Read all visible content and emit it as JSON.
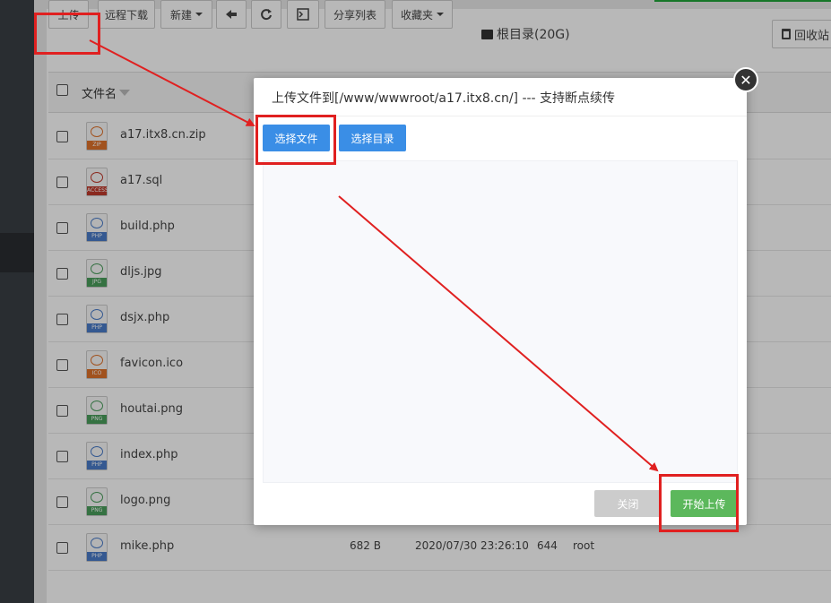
{
  "colors": {
    "accent": "#20a53a",
    "primary_button": "#3a8ee6",
    "success_button": "#5cb85c",
    "disabled_button": "#cccccc",
    "highlight": "#e02020"
  },
  "toolbar": {
    "upload_label": "上传",
    "remote_download_label": "远程下载",
    "new_label": "新建",
    "back_icon": "arrow-left-icon",
    "refresh_icon": "refresh-icon",
    "terminal_icon": "terminal-icon",
    "share_list_label": "分享列表",
    "favorites_label": "收藏夹",
    "root_dir_label": "根目录(20G)",
    "recycle_label": "回收站"
  },
  "table": {
    "header_name": "文件名",
    "rows": [
      {
        "name": "a17.itx8.cn.zip",
        "type": "ZIP",
        "size": "",
        "time": "",
        "perm": "",
        "owner": ""
      },
      {
        "name": "a17.sql",
        "type": "ACCESS",
        "size": "",
        "time": "",
        "perm": "",
        "owner": ""
      },
      {
        "name": "build.php",
        "type": "PHP",
        "size": "",
        "time": "",
        "perm": "",
        "owner": ""
      },
      {
        "name": "dljs.jpg",
        "type": "JPG",
        "size": "",
        "time": "",
        "perm": "",
        "owner": ""
      },
      {
        "name": "dsjx.php",
        "type": "PHP",
        "size": "",
        "time": "",
        "perm": "",
        "owner": ""
      },
      {
        "name": "favicon.ico",
        "type": "ICO",
        "size": "",
        "time": "",
        "perm": "",
        "owner": ""
      },
      {
        "name": "houtai.png",
        "type": "PNG",
        "size": "",
        "time": "",
        "perm": "",
        "owner": ""
      },
      {
        "name": "index.php",
        "type": "PHP",
        "size": "",
        "time": "",
        "perm": "",
        "owner": ""
      },
      {
        "name": "logo.png",
        "type": "PNG",
        "size": "",
        "time": "",
        "perm": "",
        "owner": ""
      },
      {
        "name": "mike.php",
        "type": "PHP",
        "size": "682 B",
        "time": "2020/07/30 23:26:10",
        "perm": "644",
        "owner": "root"
      }
    ]
  },
  "dialog": {
    "title": "上传文件到[/www/wwwroot/a17.itx8.cn/] --- 支持断点续传",
    "select_file_label": "选择文件",
    "select_dir_label": "选择目录",
    "close_label": "关闭",
    "start_upload_label": "开始上传",
    "close_icon": "close-icon"
  }
}
